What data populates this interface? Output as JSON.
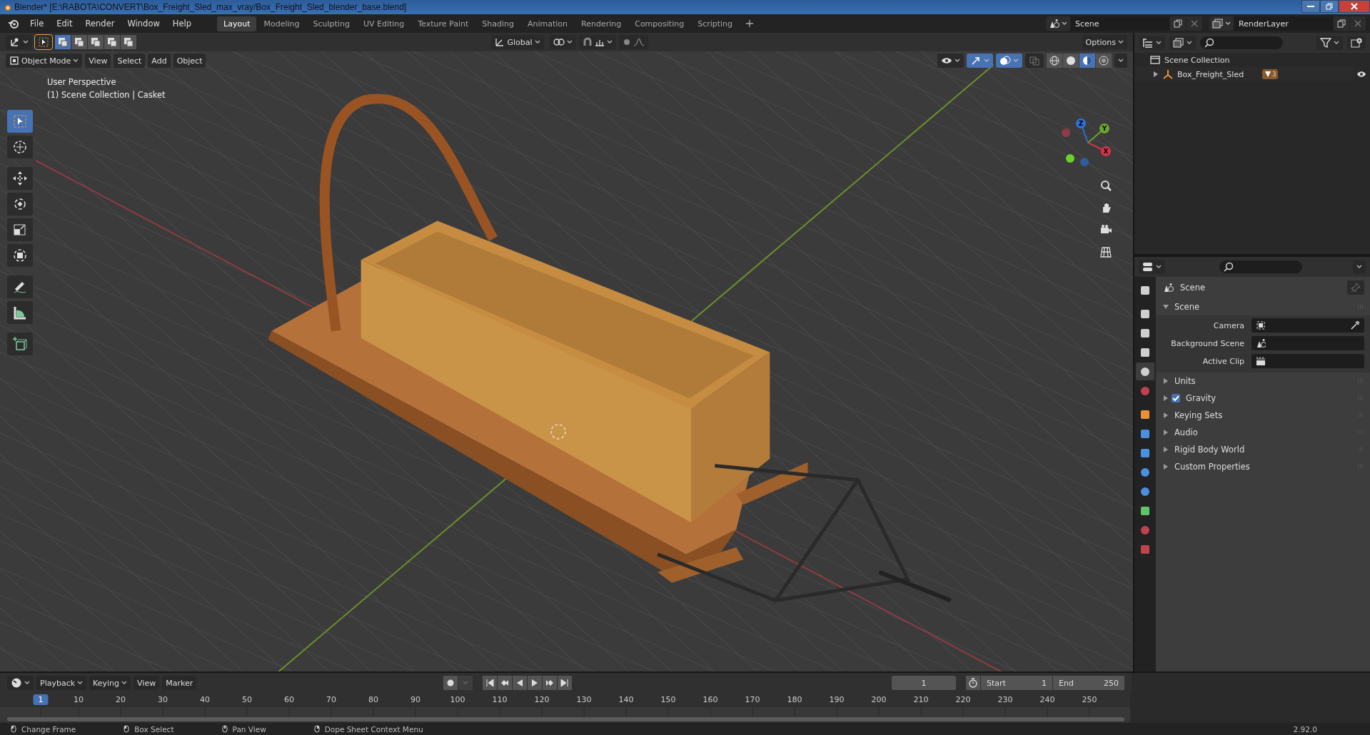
{
  "window": {
    "title": "Blender* [E:\\RABOTA\\CONVERT\\Box_Freight_Sled_max_vray/Box_Freight_Sled_blender_base.blend]"
  },
  "menu": [
    "File",
    "Edit",
    "Render",
    "Window",
    "Help"
  ],
  "workspaces": [
    {
      "label": "Layout",
      "selected": true
    },
    {
      "label": "Modeling",
      "selected": false
    },
    {
      "label": "Sculpting",
      "selected": false
    },
    {
      "label": "UV Editing",
      "selected": false
    },
    {
      "label": "Texture Paint",
      "selected": false
    },
    {
      "label": "Shading",
      "selected": false
    },
    {
      "label": "Animation",
      "selected": false
    },
    {
      "label": "Rendering",
      "selected": false
    },
    {
      "label": "Compositing",
      "selected": false
    },
    {
      "label": "Scripting",
      "selected": false
    }
  ],
  "scene_selector": {
    "value": "Scene"
  },
  "view_layer_selector": {
    "value": "RenderLayer"
  },
  "viewport": {
    "orientation": "Global",
    "options": "Options",
    "mode": "Object Mode",
    "menus": [
      "View",
      "Select",
      "Add",
      "Object"
    ],
    "overlay_text": [
      "User Perspective",
      "(1) Scene Collection | Casket"
    ],
    "tools": [
      {
        "kind": "select",
        "selected": true
      },
      {
        "kind": "cursor",
        "selected": false
      },
      {
        "kind": "move",
        "selected": false
      },
      {
        "kind": "rotate",
        "selected": false
      },
      {
        "kind": "scale",
        "selected": false
      },
      {
        "kind": "transform",
        "selected": false
      },
      {
        "kind": "annotate",
        "selected": false
      },
      {
        "kind": "measure",
        "selected": false
      },
      {
        "kind": "add",
        "selected": false
      }
    ],
    "gizmo_axes": [
      {
        "label": "Z",
        "color": "#2f6fd6"
      },
      {
        "label": "Y",
        "color": "#6da52c"
      },
      {
        "label": "X",
        "color": "#d6334a"
      }
    ],
    "shading_modes": [
      {
        "kind": "wireframe",
        "selected": false
      },
      {
        "kind": "solid",
        "selected": false
      },
      {
        "kind": "material",
        "selected": true
      },
      {
        "kind": "rendered",
        "selected": false
      }
    ]
  },
  "outliner": {
    "root": "Scene Collection",
    "children": [
      {
        "label": "Box_Freight_Sled",
        "expanded": false,
        "badge": "3"
      }
    ]
  },
  "properties": {
    "tabs": [
      {
        "kind": "square",
        "color": "#cfcfcf",
        "selected": false
      },
      {
        "kind": "square",
        "color": "#cfcfcf",
        "selected": false
      },
      {
        "kind": "square",
        "color": "#cfcfcf",
        "selected": false
      },
      {
        "kind": "square",
        "color": "#cfcfcf",
        "selected": false
      },
      {
        "kind": "circle",
        "color": "#cfcfcf",
        "selected": true
      },
      {
        "kind": "circle",
        "color": "#c0424e",
        "selected": false
      },
      {
        "kind": "square",
        "color": "#e8903a",
        "selected": false
      },
      {
        "kind": "square",
        "color": "#4a8fe0",
        "selected": false
      },
      {
        "kind": "square",
        "color": "#4a8fe0",
        "selected": false
      },
      {
        "kind": "circle",
        "color": "#4a8fe0",
        "selected": false
      },
      {
        "kind": "circle",
        "color": "#4a8fe0",
        "selected": false
      },
      {
        "kind": "square",
        "color": "#5fc46a",
        "selected": false
      },
      {
        "kind": "circle",
        "color": "#c0424e",
        "selected": false
      },
      {
        "kind": "square",
        "color": "#c0424e",
        "selected": false
      }
    ],
    "context": "Scene",
    "panels": [
      {
        "title": "Scene",
        "kind": "plain",
        "expanded": true,
        "fields": [
          {
            "label": "Camera",
            "kind": "camera"
          },
          {
            "label": "Background Scene",
            "kind": "scene"
          },
          {
            "label": "Active Clip",
            "kind": "clip"
          }
        ]
      },
      {
        "title": "Units",
        "kind": "plain",
        "expanded": false
      },
      {
        "title": "Gravity",
        "kind": "checkbox",
        "checked": true,
        "expanded": false
      },
      {
        "title": "Keying Sets",
        "kind": "plain",
        "expanded": false
      },
      {
        "title": "Audio",
        "kind": "plain",
        "expanded": false
      },
      {
        "title": "Rigid Body World",
        "kind": "plain",
        "expanded": false
      },
      {
        "title": "Custom Properties",
        "kind": "plain",
        "expanded": false
      }
    ]
  },
  "timeline": {
    "menus": [
      "Playback",
      "Keying",
      "View",
      "Marker"
    ],
    "current_frame": "1",
    "start_label": "Start",
    "start": "1",
    "end_label": "End",
    "end": "250",
    "ruler": [
      {
        "label": "1",
        "selected": true
      },
      {
        "label": "10",
        "selected": false
      },
      {
        "label": "20",
        "selected": false
      },
      {
        "label": "30",
        "selected": false
      },
      {
        "label": "40",
        "selected": false
      },
      {
        "label": "50",
        "selected": false
      },
      {
        "label": "60",
        "selected": false
      },
      {
        "label": "70",
        "selected": false
      },
      {
        "label": "80",
        "selected": false
      },
      {
        "label": "90",
        "selected": false
      },
      {
        "label": "100",
        "selected": false
      },
      {
        "label": "110",
        "selected": false
      },
      {
        "label": "120",
        "selected": false
      },
      {
        "label": "130",
        "selected": false
      },
      {
        "label": "140",
        "selected": false
      },
      {
        "label": "150",
        "selected": false
      },
      {
        "label": "160",
        "selected": false
      },
      {
        "label": "170",
        "selected": false
      },
      {
        "label": "180",
        "selected": false
      },
      {
        "label": "190",
        "selected": false
      },
      {
        "label": "200",
        "selected": false
      },
      {
        "label": "210",
        "selected": false
      },
      {
        "label": "220",
        "selected": false
      },
      {
        "label": "230",
        "selected": false
      },
      {
        "label": "240",
        "selected": false
      },
      {
        "label": "250",
        "selected": false
      }
    ]
  },
  "status_bar": {
    "hints": [
      "Change Frame",
      "Box Select",
      "Pan View",
      "Dope Sheet Context Menu"
    ],
    "version": "2.92.0"
  }
}
